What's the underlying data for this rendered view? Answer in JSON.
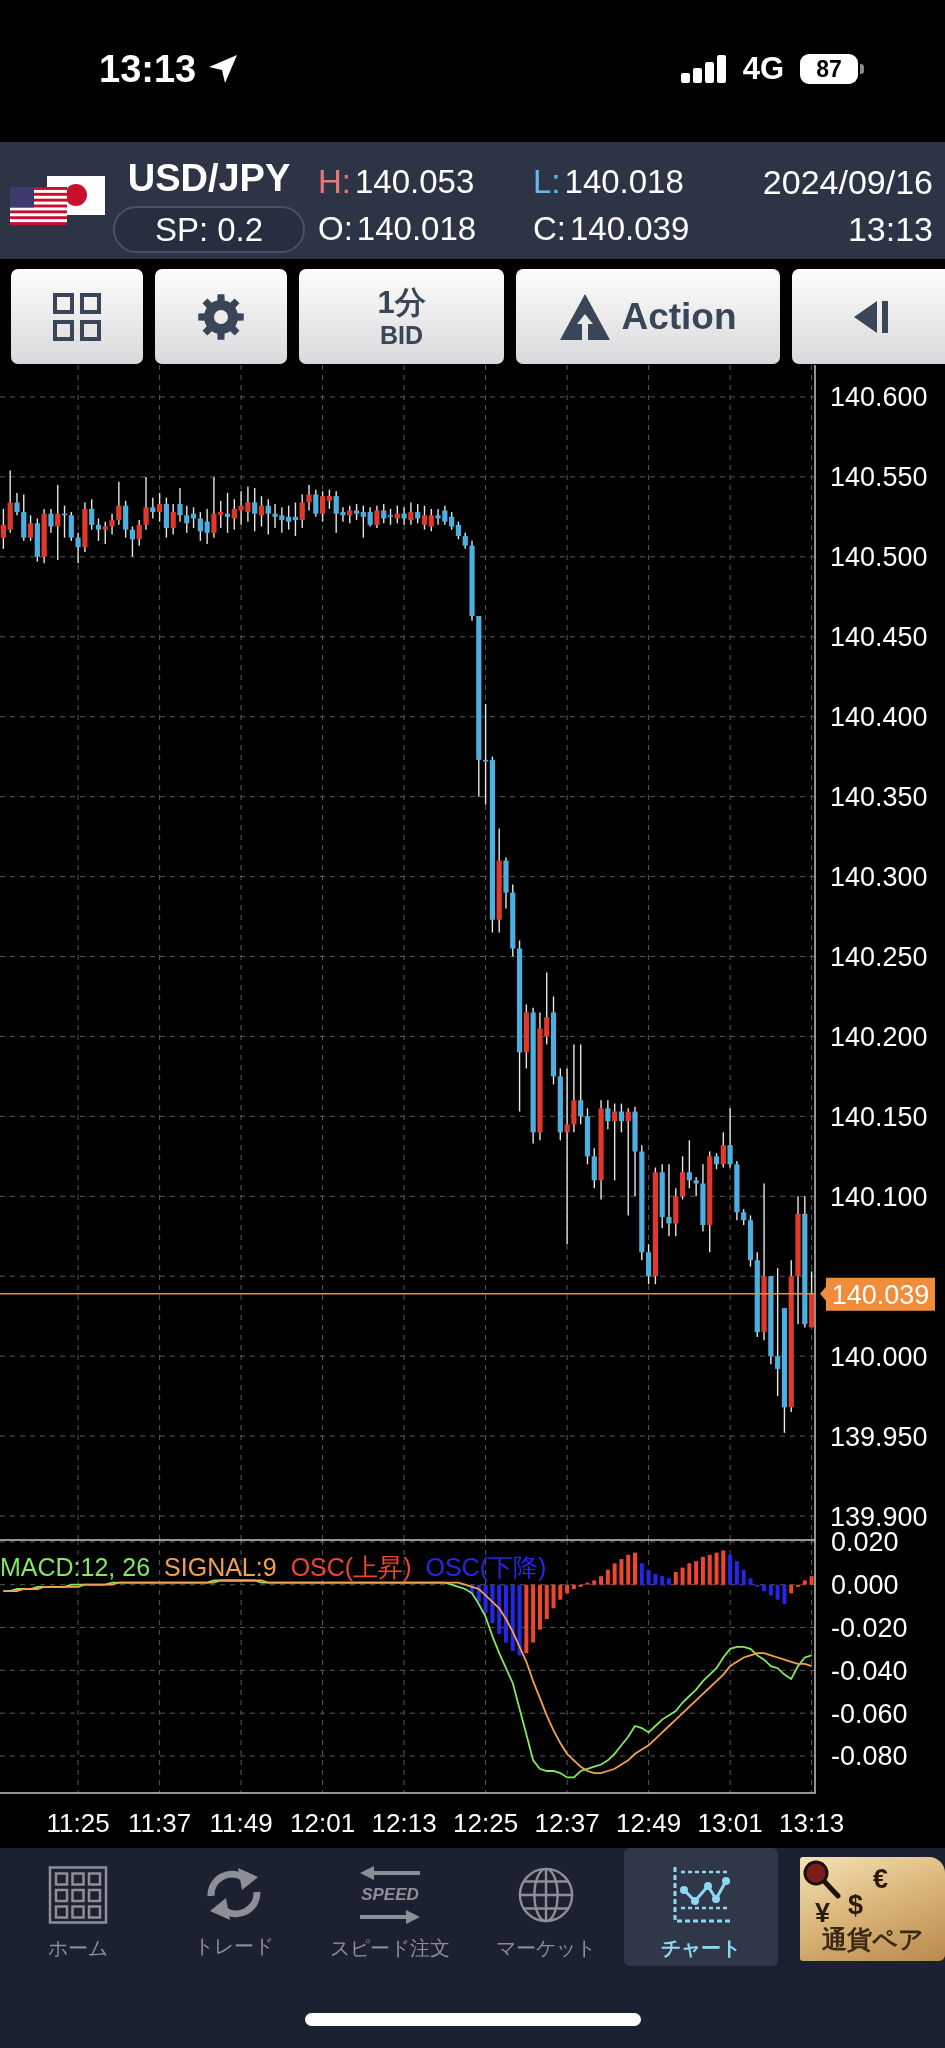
{
  "status_bar": {
    "time": "13:13",
    "network": "4G",
    "battery": "87"
  },
  "quote": {
    "symbol": "USD/JPY",
    "spread": "SP: 0.2",
    "stats": [
      {
        "label": "H:",
        "value": "140.053",
        "color": "#e57b73"
      },
      {
        "label": "L:",
        "value": "140.018",
        "color": "#62bbe8"
      },
      {
        "label": "O:",
        "value": "140.018",
        "color": "#ffffff"
      },
      {
        "label": "C:",
        "value": "140.039",
        "color": "#ffffff"
      }
    ],
    "date": "2024/09/16",
    "time": "13:13"
  },
  "toolbar": {
    "buttons": [
      {
        "kind": "layout"
      },
      {
        "kind": "settings"
      },
      {
        "kind": "timeframe",
        "label": "1分",
        "sublabel": "BID"
      },
      {
        "kind": "action",
        "label": "Action"
      },
      {
        "kind": "collapse"
      }
    ]
  },
  "chart": {
    "price": {
      "chart_data": {
        "type": "candlestick",
        "grid": true,
        "categories": [
          null,
          null,
          null,
          null,
          null,
          null,
          null,
          null,
          null,
          null,
          null,
          null,
          null,
          null,
          null,
          null,
          null,
          null,
          null,
          null,
          null,
          null,
          null,
          null,
          null,
          null,
          null,
          null,
          null,
          null,
          null,
          null,
          null,
          null,
          null,
          null,
          null,
          null,
          null,
          null,
          null,
          null,
          null,
          null,
          null,
          null,
          null,
          null,
          null,
          null,
          null,
          null,
          null,
          null,
          null,
          null,
          null,
          null,
          null,
          null,
          null,
          null,
          null,
          null,
          null,
          null,
          null,
          null,
          null,
          null,
          null,
          null,
          null,
          null,
          null,
          null,
          null,
          null,
          null,
          null,
          null,
          null,
          null,
          null,
          null,
          null,
          null,
          null,
          null,
          null,
          null,
          null,
          null,
          null,
          null,
          null,
          null,
          null,
          null,
          null,
          null,
          null,
          null,
          null,
          null,
          null,
          null,
          null,
          null,
          null,
          null,
          null,
          null,
          null,
          null,
          null,
          null,
          null,
          null,
          null
        ],
        "ylim": [
          139.885,
          140.62
        ],
        "yticks": [
          {
            "value": 140.6,
            "label": "140.600"
          },
          {
            "value": 140.55,
            "label": "140.550"
          },
          {
            "value": 140.5,
            "label": "140.500"
          },
          {
            "value": 140.45,
            "label": "140.450"
          },
          {
            "value": 140.4,
            "label": "140.400"
          },
          {
            "value": 140.35,
            "label": "140.350"
          },
          {
            "value": 140.3,
            "label": "140.300"
          },
          {
            "value": 140.25,
            "label": "140.250"
          },
          {
            "value": 140.2,
            "label": "140.200"
          },
          {
            "value": 140.15,
            "label": "140.150"
          },
          {
            "value": 140.1,
            "label": "140.100"
          },
          {
            "value": 140,
            "label": "140.000"
          },
          {
            "value": 139.95,
            "label": "139.950"
          },
          {
            "value": 139.9,
            "label": "139.900"
          }
        ],
        "ohlc": [
          [
            140.512,
            140.53,
            140.505,
            140.52
          ],
          [
            140.517,
            140.554,
            140.515,
            140.534
          ],
          [
            140.534,
            140.54,
            140.526,
            140.528
          ],
          [
            140.528,
            140.539,
            140.51,
            140.512
          ],
          [
            140.512,
            140.526,
            140.51,
            140.521
          ],
          [
            140.521,
            140.524,
            140.497,
            140.5
          ],
          [
            140.5,
            140.53,
            140.496,
            140.527
          ],
          [
            140.527,
            140.53,
            140.515,
            140.519
          ],
          [
            140.519,
            140.545,
            140.498,
            140.527
          ],
          [
            140.527,
            140.532,
            140.512,
            140.526
          ],
          [
            140.526,
            140.528,
            140.51,
            140.512
          ],
          [
            140.512,
            140.515,
            140.496,
            140.506
          ],
          [
            140.506,
            140.534,
            140.503,
            140.53
          ],
          [
            140.53,
            140.536,
            140.517,
            140.52
          ],
          [
            140.52,
            140.524,
            140.51,
            140.517
          ],
          [
            140.517,
            140.522,
            140.508,
            140.519
          ],
          [
            140.519,
            140.527,
            140.514,
            140.523
          ],
          [
            140.523,
            140.547,
            140.52,
            140.532
          ],
          [
            140.532,
            140.535,
            140.512,
            140.517
          ],
          [
            140.517,
            140.519,
            140.5,
            140.511
          ],
          [
            140.511,
            140.523,
            140.507,
            140.52
          ],
          [
            140.52,
            140.55,
            140.517,
            140.531
          ],
          [
            140.531,
            140.537,
            140.524,
            140.528
          ],
          [
            140.528,
            140.54,
            140.522,
            140.533
          ],
          [
            140.533,
            140.537,
            140.512,
            140.518
          ],
          [
            140.518,
            140.533,
            140.514,
            140.528
          ],
          [
            140.533,
            140.543,
            140.522,
            140.526
          ],
          [
            140.526,
            140.532,
            140.515,
            140.521
          ],
          [
            140.527,
            140.531,
            140.518,
            140.524
          ],
          [
            140.524,
            140.528,
            140.51,
            140.516
          ],
          [
            140.522,
            140.53,
            140.508,
            140.515
          ],
          [
            140.515,
            140.55,
            140.512,
            140.527
          ],
          [
            140.526,
            140.535,
            140.518,
            140.528
          ],
          [
            140.527,
            140.54,
            140.515,
            140.525
          ],
          [
            140.524,
            140.536,
            140.517,
            140.53
          ],
          [
            140.529,
            140.541,
            140.52,
            140.532
          ],
          [
            140.528,
            140.544,
            140.522,
            140.534
          ],
          [
            140.534,
            140.543,
            140.516,
            140.527
          ],
          [
            140.526,
            140.538,
            140.519,
            140.532
          ],
          [
            140.532,
            140.536,
            140.514,
            140.527
          ],
          [
            140.527,
            140.533,
            140.518,
            140.525
          ],
          [
            140.526,
            140.531,
            140.515,
            140.523
          ],
          [
            140.525,
            140.532,
            140.517,
            140.522
          ],
          [
            140.525,
            140.534,
            140.513,
            140.523
          ],
          [
            140.523,
            140.539,
            140.518,
            140.534
          ],
          [
            140.534,
            140.545,
            140.529,
            140.539
          ],
          [
            140.539,
            140.542,
            140.525,
            140.527
          ],
          [
            140.527,
            140.541,
            140.522,
            140.538
          ],
          [
            140.535,
            140.542,
            140.53,
            140.538
          ],
          [
            140.538,
            140.541,
            140.515,
            140.527
          ],
          [
            140.528,
            140.531,
            140.522,
            140.526
          ],
          [
            140.526,
            140.532,
            140.521,
            140.529
          ],
          [
            140.529,
            140.533,
            140.523,
            140.527
          ],
          [
            140.528,
            140.532,
            140.512,
            140.525
          ],
          [
            140.528,
            140.531,
            140.519,
            140.52
          ],
          [
            140.52,
            140.532,
            140.518,
            140.529
          ],
          [
            140.529,
            140.533,
            140.521,
            140.524
          ],
          [
            140.526,
            140.53,
            140.52,
            140.525
          ],
          [
            140.524,
            140.532,
            140.521,
            140.527
          ],
          [
            140.527,
            140.531,
            140.52,
            140.524
          ],
          [
            140.523,
            140.534,
            140.52,
            140.528
          ],
          [
            140.528,
            140.533,
            140.521,
            140.524
          ],
          [
            140.52,
            140.532,
            140.517,
            140.526
          ],
          [
            140.519,
            140.53,
            140.516,
            140.526
          ],
          [
            140.526,
            140.53,
            140.52,
            140.524
          ],
          [
            140.529,
            140.532,
            140.52,
            140.522
          ],
          [
            140.525,
            140.528,
            140.517,
            140.519
          ],
          [
            140.52,
            140.522,
            140.511,
            140.513
          ],
          [
            140.513,
            140.515,
            140.505,
            140.507
          ],
          [
            140.507,
            140.51,
            140.46,
            140.463
          ],
          [
            140.463,
            140.463,
            140.35,
            140.373
          ],
          [
            140.373,
            140.408,
            140.345,
            140.372
          ],
          [
            140.373,
            140.375,
            140.265,
            140.273
          ],
          [
            140.273,
            140.33,
            140.265,
            140.31
          ],
          [
            140.31,
            140.312,
            140.28,
            140.29
          ],
          [
            140.29,
            140.295,
            140.25,
            140.255
          ],
          [
            140.255,
            140.26,
            140.153,
            140.19
          ],
          [
            140.19,
            140.22,
            140.18,
            140.215
          ],
          [
            140.215,
            140.218,
            140.133,
            140.14
          ],
          [
            140.14,
            140.215,
            140.135,
            140.205
          ],
          [
            140.2,
            140.24,
            140.195,
            140.212
          ],
          [
            140.215,
            140.225,
            140.17,
            140.175
          ],
          [
            140.175,
            140.18,
            140.135,
            140.14
          ],
          [
            140.14,
            140.18,
            140.07,
            140.145
          ],
          [
            140.145,
            140.195,
            140.14,
            140.16
          ],
          [
            140.16,
            140.195,
            140.145,
            140.15
          ],
          [
            140.15,
            140.155,
            140.12,
            140.125
          ],
          [
            140.125,
            140.13,
            140.105,
            140.11
          ],
          [
            140.11,
            140.16,
            140.098,
            140.155
          ],
          [
            140.155,
            140.16,
            140.142,
            140.147
          ],
          [
            140.147,
            140.158,
            140.11,
            140.153
          ],
          [
            140.153,
            140.158,
            140.14,
            140.147
          ],
          [
            140.147,
            140.155,
            140.088,
            140.153
          ],
          [
            140.153,
            140.156,
            140.1,
            140.128
          ],
          [
            140.128,
            140.132,
            140.06,
            140.065
          ],
          [
            140.065,
            140.07,
            140.045,
            140.05
          ],
          [
            140.05,
            140.118,
            140.045,
            140.115
          ],
          [
            140.115,
            140.12,
            140.08,
            140.087
          ],
          [
            140.087,
            140.12,
            140.075,
            140.083
          ],
          [
            140.083,
            140.105,
            140.075,
            140.1
          ],
          [
            140.1,
            140.125,
            140.098,
            140.115
          ],
          [
            140.115,
            140.135,
            140.105,
            140.11
          ],
          [
            140.11,
            140.112,
            140.1,
            140.108
          ],
          [
            140.108,
            140.12,
            140.078,
            140.082
          ],
          [
            140.082,
            140.128,
            140.065,
            140.125
          ],
          [
            140.125,
            140.127,
            140.117,
            140.12
          ],
          [
            140.12,
            140.14,
            140.118,
            140.132
          ],
          [
            140.132,
            140.155,
            140.118,
            140.12
          ],
          [
            140.12,
            140.122,
            140.085,
            140.09
          ],
          [
            140.09,
            140.092,
            140.082,
            140.085
          ],
          [
            140.085,
            140.088,
            140.056,
            140.06
          ],
          [
            140.06,
            140.065,
            140.012,
            140.015
          ],
          [
            140.015,
            140.108,
            140.01,
            140.05
          ],
          [
            140.05,
            140.05,
            139.995,
            140
          ],
          [
            140,
            140.055,
            139.975,
            139.992
          ],
          [
            140.03,
            140.03,
            139.952,
            139.968
          ],
          [
            139.968,
            140.06,
            139.965,
            140.05
          ],
          [
            140.05,
            140.1,
            140.02,
            140.089
          ],
          [
            140.089,
            140.1,
            140.018,
            140.02
          ],
          [
            140.018,
            140.053,
            140.018,
            140.039
          ]
        ]
      },
      "current_price": "140.039"
    },
    "macd": {
      "chart_data": {
        "type": "line",
        "grid": true,
        "categories": [
          null,
          null,
          null,
          null,
          null,
          null,
          null,
          null,
          null,
          null,
          null,
          "11:25",
          null,
          null,
          null,
          null,
          null,
          null,
          null,
          null,
          null,
          null,
          null,
          "11:37",
          null,
          null,
          null,
          null,
          null,
          null,
          null,
          null,
          null,
          null,
          null,
          "11:49",
          null,
          null,
          null,
          null,
          null,
          null,
          null,
          null,
          null,
          null,
          null,
          "12:01",
          null,
          null,
          null,
          null,
          null,
          null,
          null,
          null,
          null,
          null,
          null,
          "12:13",
          null,
          null,
          null,
          null,
          null,
          null,
          null,
          null,
          null,
          null,
          null,
          "12:25",
          null,
          null,
          null,
          null,
          null,
          null,
          null,
          null,
          null,
          null,
          null,
          "12:37",
          null,
          null,
          null,
          null,
          null,
          null,
          null,
          null,
          null,
          null,
          null,
          "12:49",
          null,
          null,
          null,
          null,
          null,
          null,
          null,
          null,
          null,
          null,
          null,
          "13:01",
          null,
          null,
          null,
          null,
          null,
          null,
          null,
          null,
          null,
          null,
          null,
          "13:13"
        ],
        "ylim": [
          -0.0973,
          0.0209
        ],
        "yticks": [
          {
            "value": 0.02,
            "label": "0.020"
          },
          {
            "value": 0,
            "label": "0.000"
          },
          {
            "value": -0.02,
            "label": "-0.020"
          },
          {
            "value": -0.04,
            "label": "-0.040"
          },
          {
            "value": -0.06,
            "label": "-0.060"
          },
          {
            "value": -0.08,
            "label": "-0.080"
          }
        ],
        "series": [
          {
            "name": "MACD:12, 26",
            "color": "#84e860",
            "values": [
              -0.003,
              -0.003,
              -0.002,
              -0.002,
              -0.002,
              -0.001,
              -0.001,
              -0.001,
              -0.001,
              -0.001,
              0,
              0,
              0,
              0,
              0,
              0,
              0.001,
              0.001,
              0.001,
              0.001,
              0.001,
              0.001,
              0.001,
              0.001,
              0.001,
              0.001,
              0.001,
              0.001,
              0.001,
              0.001,
              0.001,
              0.002,
              0.002,
              0.002,
              0.002,
              0.002,
              0.002,
              0.002,
              0.001,
              0.001,
              0.001,
              0.001,
              0.001,
              0.001,
              0.001,
              0.001,
              0.001,
              0.001,
              0.001,
              0.001,
              0.001,
              0.001,
              0.001,
              0.001,
              0.001,
              0.001,
              0.001,
              0.001,
              0.001,
              0.001,
              0.001,
              0.001,
              0.001,
              0.001,
              0.001,
              0.001,
              0,
              -0.001,
              -0.002,
              -0.004,
              -0.009,
              -0.015,
              -0.024,
              -0.032,
              -0.039,
              -0.046,
              -0.058,
              -0.07,
              -0.082,
              -0.086,
              -0.087,
              -0.087,
              -0.088,
              -0.09,
              -0.09,
              -0.087,
              -0.086,
              -0.085,
              -0.084,
              -0.082,
              -0.079,
              -0.075,
              -0.071,
              -0.066,
              -0.067,
              -0.069,
              -0.066,
              -0.063,
              -0.061,
              -0.059,
              -0.055,
              -0.052,
              -0.049,
              -0.045,
              -0.042,
              -0.039,
              -0.034,
              -0.03,
              -0.029,
              -0.029,
              -0.03,
              -0.033,
              -0.035,
              -0.038,
              -0.039,
              -0.042,
              -0.044,
              -0.038,
              -0.034,
              -0.033
            ]
          },
          {
            "name": "SIGNAL:9",
            "color": "#f2a24c",
            "values": [
              -0.003,
              -0.003,
              -0.003,
              -0.002,
              -0.002,
              -0.002,
              -0.001,
              -0.001,
              -0.001,
              -0.001,
              -0.001,
              -0.001,
              0,
              0,
              0,
              0,
              0,
              0.001,
              0.001,
              0.001,
              0.001,
              0.001,
              0.001,
              0.001,
              0.001,
              0.001,
              0.001,
              0.001,
              0.001,
              0.001,
              0.001,
              0.001,
              0.002,
              0.002,
              0.002,
              0.002,
              0.002,
              0.002,
              0.002,
              0.001,
              0.001,
              0.001,
              0.001,
              0.001,
              0.001,
              0.001,
              0.001,
              0.001,
              0.001,
              0.001,
              0.001,
              0.001,
              0.001,
              0.001,
              0.001,
              0.001,
              0.001,
              0.001,
              0.001,
              0.001,
              0.001,
              0.001,
              0.001,
              0.001,
              0.001,
              0.001,
              0.001,
              0.001,
              0,
              -0.001,
              -0.002,
              -0.005,
              -0.008,
              -0.011,
              -0.016,
              -0.022,
              -0.029,
              -0.036,
              -0.045,
              -0.053,
              -0.061,
              -0.068,
              -0.074,
              -0.079,
              -0.082,
              -0.085,
              -0.087,
              -0.088,
              -0.088,
              -0.087,
              -0.086,
              -0.084,
              -0.082,
              -0.079,
              -0.077,
              -0.075,
              -0.072,
              -0.069,
              -0.066,
              -0.063,
              -0.06,
              -0.057,
              -0.054,
              -0.051,
              -0.048,
              -0.045,
              -0.042,
              -0.038,
              -0.036,
              -0.034,
              -0.033,
              -0.032,
              -0.032,
              -0.033,
              -0.034,
              -0.035,
              -0.036,
              -0.037,
              -0.037,
              -0.038
            ]
          },
          {
            "name": "OSC(上昇)",
            "color": "#ee4632",
            "type": "bar",
            "values": [
              null,
              null,
              null,
              null,
              null,
              null,
              null,
              null,
              null,
              null,
              null,
              null,
              null,
              null,
              null,
              null,
              null,
              null,
              null,
              null,
              null,
              null,
              null,
              null,
              null,
              null,
              null,
              null,
              null,
              null,
              null,
              null,
              null,
              null,
              null,
              null,
              null,
              null,
              null,
              null,
              null,
              null,
              null,
              null,
              null,
              null,
              null,
              null,
              null,
              null,
              null,
              null,
              null,
              null,
              null,
              null,
              null,
              null,
              null,
              null,
              null,
              null,
              null,
              null,
              null,
              null,
              null,
              null,
              null,
              null,
              null,
              null,
              null,
              null,
              null,
              null,
              null,
              -0.032,
              -0.027,
              -0.021,
              -0.016,
              -0.011,
              -0.007,
              -0.004,
              -0.002,
              -0.001,
              0.001,
              0.002,
              0.004,
              0.007,
              0.01,
              0.012,
              0.014,
              0.015,
              null,
              null,
              null,
              null,
              null,
              0.006,
              0.008,
              0.01,
              0.011,
              0.013,
              0.014,
              0.015,
              0.016,
              null,
              null,
              null,
              null,
              null,
              null,
              null,
              null,
              null,
              -0.004,
              -0.001,
              0.002,
              0.004
            ]
          },
          {
            "name": "OSC(下降)",
            "color": "#2626e6",
            "type": "bar",
            "values": [
              null,
              null,
              null,
              null,
              null,
              null,
              null,
              null,
              null,
              null,
              null,
              null,
              null,
              null,
              null,
              null,
              null,
              null,
              null,
              null,
              null,
              null,
              null,
              null,
              null,
              null,
              null,
              null,
              null,
              null,
              null,
              null,
              null,
              null,
              null,
              null,
              null,
              null,
              null,
              null,
              null,
              null,
              null,
              null,
              null,
              null,
              null,
              null,
              null,
              null,
              null,
              null,
              null,
              null,
              null,
              null,
              null,
              null,
              null,
              null,
              null,
              null,
              null,
              null,
              null,
              null,
              null,
              null,
              null,
              -0.004,
              -0.008,
              -0.013,
              -0.018,
              -0.023,
              -0.027,
              -0.031,
              -0.033,
              null,
              null,
              null,
              null,
              null,
              null,
              null,
              null,
              null,
              null,
              null,
              null,
              null,
              null,
              null,
              null,
              null,
              0.01,
              0.007,
              0.005,
              0.004,
              0.003,
              null,
              null,
              null,
              null,
              null,
              null,
              null,
              null,
              0.014,
              0.011,
              0.007,
              0.003,
              -0.001,
              -0.003,
              -0.005,
              -0.007,
              -0.009,
              null,
              null,
              null,
              null
            ]
          }
        ]
      }
    }
  },
  "nav": [
    {
      "kind": "home",
      "label": "ホーム",
      "selected": false
    },
    {
      "kind": "trade",
      "label": "トレード",
      "selected": false
    },
    {
      "kind": "speed",
      "label": "スピード注文",
      "icon_text": "SPEED",
      "selected": false
    },
    {
      "kind": "market",
      "label": "マーケット",
      "selected": false
    },
    {
      "kind": "chart",
      "label": "チャート",
      "selected": true
    },
    {
      "kind": "pairs",
      "label": "通貨ペア",
      "symbols": [
        "€",
        "$",
        "¥"
      ],
      "selected": false
    }
  ]
}
